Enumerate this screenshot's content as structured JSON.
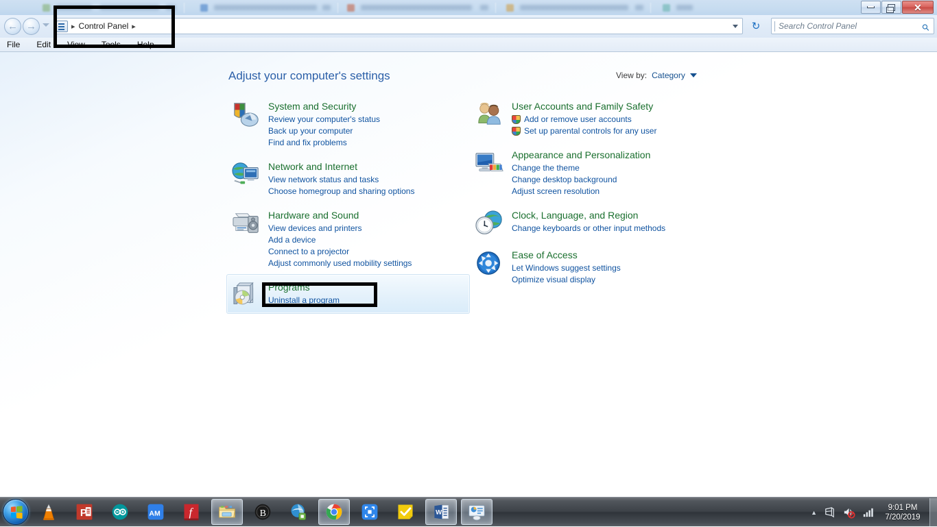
{
  "window": {
    "title": "Control Panel",
    "controls": {
      "minimize": "minimize",
      "restore": "restore",
      "close": "✕"
    }
  },
  "navigation": {
    "back_glyph": "←",
    "forward_glyph": "→",
    "breadcrumb_sep_start": "▸",
    "breadcrumb_label": "Control Panel",
    "breadcrumb_sep_end": "▸",
    "refresh_glyph": "↻",
    "search_placeholder": "Search Control Panel",
    "search_value": "",
    "search_icon_glyph": "⚲"
  },
  "menubar": {
    "items": [
      "File",
      "Edit",
      "View",
      "Tools",
      "Help"
    ]
  },
  "main": {
    "heading": "Adjust your computer's settings",
    "view_by_label": "View by:",
    "view_by_value": "Category"
  },
  "categories_left": [
    {
      "icon": "shield-and-chart-icon",
      "title": "System and Security",
      "highlighted": false,
      "links": [
        {
          "label": "Review your computer's status",
          "shield": false,
          "underline": false
        },
        {
          "label": "Back up your computer",
          "shield": false,
          "underline": false
        },
        {
          "label": "Find and fix problems",
          "shield": false,
          "underline": false
        }
      ]
    },
    {
      "icon": "globe-and-monitor-icon",
      "title": "Network and Internet",
      "highlighted": false,
      "links": [
        {
          "label": "View network status and tasks",
          "shield": false,
          "underline": false
        },
        {
          "label": "Choose homegroup and sharing options",
          "shield": false,
          "underline": false
        }
      ]
    },
    {
      "icon": "printer-and-speaker-icon",
      "title": "Hardware and Sound",
      "highlighted": false,
      "links": [
        {
          "label": "View devices and printers",
          "shield": false,
          "underline": false
        },
        {
          "label": "Add a device",
          "shield": false,
          "underline": false
        },
        {
          "label": "Connect to a projector",
          "shield": false,
          "underline": false
        },
        {
          "label": "Adjust commonly used mobility settings",
          "shield": false,
          "underline": false
        }
      ]
    },
    {
      "icon": "programs-box-and-disc-icon",
      "title": "Programs",
      "highlighted": true,
      "links": [
        {
          "label": "Uninstall a program",
          "shield": false,
          "underline": true
        }
      ]
    }
  ],
  "categories_right": [
    {
      "icon": "two-users-icon",
      "title": "User Accounts and Family Safety",
      "highlighted": false,
      "links": [
        {
          "label": "Add or remove user accounts",
          "shield": true,
          "underline": false
        },
        {
          "label": "Set up parental controls for any user",
          "shield": true,
          "underline": false
        }
      ]
    },
    {
      "icon": "monitor-and-palette-icon",
      "title": "Appearance and Personalization",
      "highlighted": false,
      "links": [
        {
          "label": "Change the theme",
          "shield": false,
          "underline": false
        },
        {
          "label": "Change desktop background",
          "shield": false,
          "underline": false
        },
        {
          "label": "Adjust screen resolution",
          "shield": false,
          "underline": false
        }
      ]
    },
    {
      "icon": "clock-and-globe-icon",
      "title": "Clock, Language, and Region",
      "highlighted": false,
      "links": [
        {
          "label": "Change keyboards or other input methods",
          "shield": false,
          "underline": false
        }
      ]
    },
    {
      "icon": "ease-of-access-icon",
      "title": "Ease of Access",
      "highlighted": false,
      "links": [
        {
          "label": "Let Windows suggest settings",
          "shield": false,
          "underline": false
        },
        {
          "label": "Optimize visual display",
          "shield": false,
          "underline": false
        }
      ]
    }
  ],
  "annotations": [
    {
      "name": "address-bar-highlight",
      "color": "#000000"
    },
    {
      "name": "uninstall-a-program-highlight",
      "color": "#000000"
    }
  ],
  "taskbar": {
    "start_button": "start-orb",
    "items": [
      {
        "name": "vlc-media-player",
        "label": "",
        "active": false
      },
      {
        "name": "powerpoint",
        "label": "P",
        "active": false
      },
      {
        "name": "arduino-ide",
        "label": "∞",
        "active": false
      },
      {
        "name": "am-app",
        "label": "AM",
        "active": false
      },
      {
        "name": "fusion-app",
        "label": "f",
        "active": false
      },
      {
        "name": "windows-explorer",
        "label": "",
        "active": true
      },
      {
        "name": "b-app",
        "label": "ᵇ",
        "active": false
      },
      {
        "name": "legacy-browser",
        "label": "",
        "active": false
      },
      {
        "name": "google-chrome",
        "label": "",
        "active": true
      },
      {
        "name": "screen-capture-tool",
        "label": "",
        "active": false
      },
      {
        "name": "tasks-note",
        "label": "✔",
        "active": false
      },
      {
        "name": "microsoft-word",
        "label": "W",
        "active": true
      },
      {
        "name": "control-panel",
        "label": "",
        "active": true
      }
    ],
    "tray": {
      "chevron": "▲",
      "icons": [
        "action-center-icon",
        "volume-muted-icon",
        "network-signal-icon"
      ],
      "time": "9:01 PM",
      "date": "7/20/2019"
    }
  },
  "colors": {
    "category_title": "#1a6f2e",
    "link": "#1053a0",
    "heading": "#2b5fa8",
    "annotation": "#000000",
    "taskbar": "#3d4248"
  }
}
